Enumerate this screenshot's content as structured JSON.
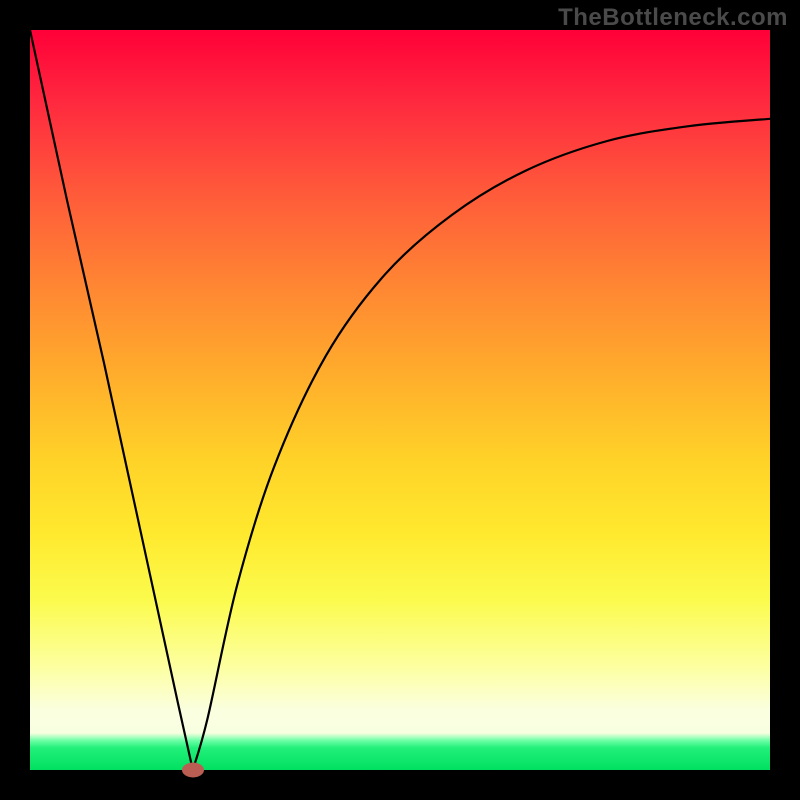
{
  "watermark": "TheBottleneck.com",
  "colors": {
    "frame": "#000000",
    "marker": "#ba5d52",
    "curve": "#000000",
    "gradient_top": "#ff0038",
    "gradient_bottom": "#00e060"
  },
  "chart_data": {
    "type": "line",
    "title": "",
    "xlabel": "",
    "ylabel": "",
    "xlim": [
      0,
      1
    ],
    "ylim": [
      0,
      1
    ],
    "note": "Axes are unlabeled in the source image; coordinates are normalized (0–1). Higher y ≈ red/worse, y=0 ≈ green/optimal. A V-shaped bottleneck curve with its minimum near x≈0.22, rising toward a plateau at right.",
    "x": [
      0.0,
      0.05,
      0.1,
      0.15,
      0.2,
      0.22,
      0.24,
      0.28,
      0.33,
      0.4,
      0.48,
      0.57,
      0.67,
      0.78,
      0.89,
      1.0
    ],
    "values": [
      1.0,
      0.77,
      0.55,
      0.32,
      0.09,
      0.0,
      0.07,
      0.25,
      0.41,
      0.56,
      0.67,
      0.75,
      0.81,
      0.85,
      0.87,
      0.88
    ],
    "marker": {
      "x": 0.22,
      "y": 0.0
    },
    "background_gradient": {
      "type": "vertical",
      "stops": [
        {
          "pos": 0.0,
          "color": "#ff0038"
        },
        {
          "pos": 0.35,
          "color": "#ff8433"
        },
        {
          "pos": 0.65,
          "color": "#ffe92e"
        },
        {
          "pos": 0.92,
          "color": "#faffe0"
        },
        {
          "pos": 1.0,
          "color": "#00e060"
        }
      ]
    }
  }
}
